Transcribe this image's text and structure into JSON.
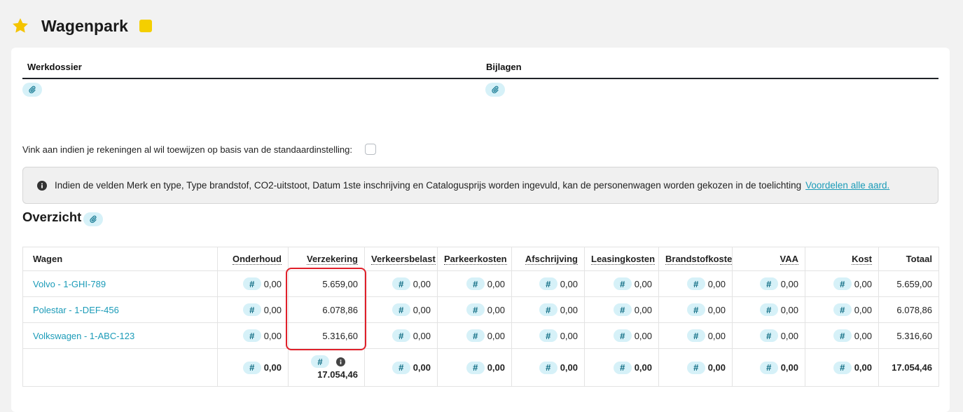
{
  "header": {
    "title": "Wagenpark",
    "star_color": "#f4c400",
    "flag_color": "#f4cf00"
  },
  "sections": {
    "werkdossier_label": "Werkdossier",
    "bijlagen_label": "Bijlagen",
    "attach_icon": "paperclip-icon"
  },
  "checkbox": {
    "label": "Vink aan indien je rekeningen al wil toewijzen op basis van de standaardinstelling:",
    "checked": false
  },
  "info": {
    "text": "Indien de velden Merk en type, Type brandstof, CO2-uitstoot, Datum 1ste inschrijving en Catalogusprijs worden ingevuld, kan de personenwagen worden gekozen in de toelichting",
    "link": "Voordelen alle aard."
  },
  "overview": {
    "title": "Overzicht",
    "columns": [
      "Wagen",
      "Onderhoud",
      "Verzekering",
      "Verkeersbelast",
      "Parkeerkosten",
      "Afschrijving",
      "Leasingkosten",
      "Brandstofkoste",
      "VAA",
      "Kost",
      "Totaal"
    ],
    "rows": [
      {
        "car": "Volvo - 1-GHI-789",
        "onderhoud": "0,00",
        "verzekering": "5.659,00",
        "verkeersbelast": "0,00",
        "parkeerkosten": "0,00",
        "afschrijving": "0,00",
        "leasingkosten": "0,00",
        "brandstofkosten": "0,00",
        "vaa": "0,00",
        "kost": "0,00",
        "totaal": "5.659,00"
      },
      {
        "car": "Polestar - 1-DEF-456",
        "onderhoud": "0,00",
        "verzekering": "6.078,86",
        "verkeersbelast": "0,00",
        "parkeerkosten": "0,00",
        "afschrijving": "0,00",
        "leasingkosten": "0,00",
        "brandstofkosten": "0,00",
        "vaa": "0,00",
        "kost": "0,00",
        "totaal": "6.078,86"
      },
      {
        "car": "Volkswagen - 1-ABC-123",
        "onderhoud": "0,00",
        "verzekering": "5.316,60",
        "verkeersbelast": "0,00",
        "parkeerkosten": "0,00",
        "afschrijving": "0,00",
        "leasingkosten": "0,00",
        "brandstofkosten": "0,00",
        "vaa": "0,00",
        "kost": "0,00",
        "totaal": "5.316,60"
      }
    ],
    "totals": {
      "onderhoud": "0,00",
      "verzekering": "17.054,46",
      "verkeersbelast": "0,00",
      "parkeerkosten": "0,00",
      "afschrijving": "0,00",
      "leasingkosten": "0,00",
      "brandstofkosten": "0,00",
      "vaa": "0,00",
      "kost": "0,00",
      "totaal": "17.054,46"
    },
    "hash_symbol": "#",
    "link_color": "#1b9bb8",
    "highlight_color": "#e0202a"
  }
}
